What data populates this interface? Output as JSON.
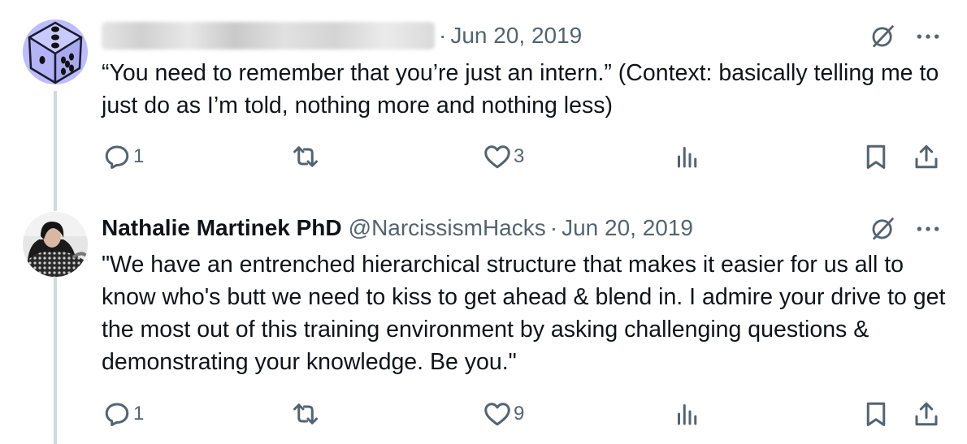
{
  "tweets": [
    {
      "name": "",
      "handle": "",
      "separator": "·",
      "date": "Jun 20, 2019",
      "text": "“You need to remember that you’re just an intern.” (Context: basically telling me to just do as I’m told, nothing more and nothing less)",
      "replies": "1",
      "reposts": "",
      "likes": "3",
      "views": ""
    },
    {
      "name": "Nathalie Martinek PhD",
      "handle": "@NarcissismHacks",
      "separator": "·",
      "date": "Jun 20, 2019",
      "text": "\"We have an entrenched hierarchical structure that makes it easier for us all to know who's butt we need to kiss to get ahead & blend in. I admire your drive to get the most out of this training environment by asking challenging questions & demonstrating your knowledge. Be you.\"",
      "replies": "1",
      "reposts": "",
      "likes": "9",
      "views": ""
    }
  ],
  "colors": {
    "text": "#0f1419",
    "muted": "#536471",
    "thread": "#cfd9de",
    "avatar_bg": "#bcbcff"
  },
  "icons": [
    "dice-avatar",
    "grok-icon",
    "more-icon",
    "reply-icon",
    "repost-icon",
    "like-icon",
    "views-icon",
    "bookmark-icon",
    "share-icon"
  ]
}
